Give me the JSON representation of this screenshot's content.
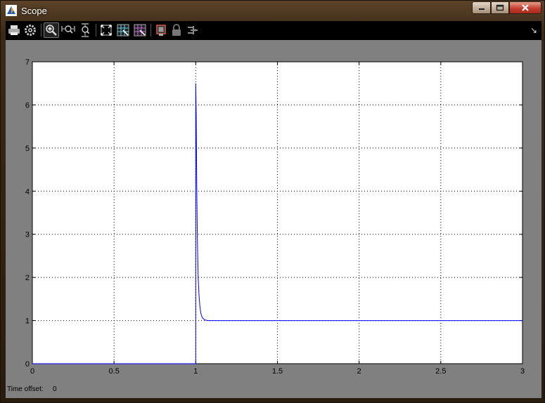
{
  "window": {
    "title": "Scope",
    "controls": [
      "minimize",
      "maximize",
      "close"
    ]
  },
  "toolbar": {
    "items": [
      {
        "icon": "print-icon",
        "tooltip": ""
      },
      {
        "icon": "parameters-gear-icon",
        "tooltip": ""
      },
      {
        "icon": "zoom-in-icon",
        "tooltip": "",
        "active": true
      },
      {
        "icon": "zoom-x-icon",
        "tooltip": ""
      },
      {
        "icon": "zoom-y-icon",
        "tooltip": ""
      },
      {
        "icon": "autoscale-icon",
        "tooltip": ""
      },
      {
        "icon": "save-axes-settings-icon",
        "tooltip": ""
      },
      {
        "icon": "restore-axes-settings-icon",
        "tooltip": ""
      },
      {
        "icon": "floating-scope-icon",
        "tooltip": ""
      },
      {
        "icon": "lock-axes-icon",
        "tooltip": ""
      },
      {
        "icon": "signal-selector-icon",
        "tooltip": ""
      }
    ],
    "dock_icon": "undock-arrow-icon"
  },
  "footer": {
    "time_offset_label": "Time offset:",
    "time_offset_value": "0"
  },
  "colors": {
    "plot_background": "#ffffff",
    "canvas_background": "#808080",
    "trace": "#0000ff",
    "grid": "#000000"
  },
  "chart_data": {
    "type": "line",
    "title": "",
    "xlabel": "",
    "ylabel": "",
    "xlim": [
      0,
      3
    ],
    "ylim": [
      0,
      7
    ],
    "xticks": [
      "0",
      "0.5",
      "1",
      "1.5",
      "2",
      "2.5",
      "3"
    ],
    "yticks": [
      "0",
      "1",
      "2",
      "3",
      "4",
      "5",
      "6",
      "7"
    ],
    "grid": true,
    "grid_style": "dotted",
    "series": [
      {
        "name": "",
        "color": "#0000ff",
        "x": [
          0,
          1.0,
          1.0,
          1.003,
          1.006,
          1.01,
          1.015,
          1.02,
          1.025,
          1.03,
          1.035,
          1.04,
          1.05,
          1.06,
          1.08,
          1.1,
          1.5,
          2,
          2.5,
          3
        ],
        "y": [
          0,
          0,
          6.5,
          5.75,
          4.2,
          2.9,
          2.0,
          1.6,
          1.35,
          1.2,
          1.12,
          1.07,
          1.03,
          1.01,
          1.0,
          1.0,
          1.0,
          1.0,
          1.0,
          1.0
        ]
      }
    ]
  }
}
